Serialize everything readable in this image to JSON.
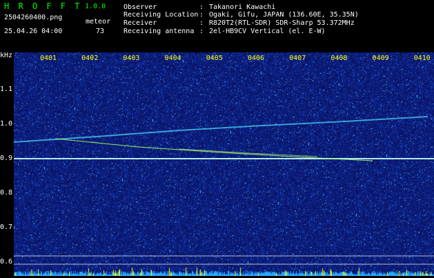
{
  "app": {
    "title": "H R O F F T",
    "version": "1.0.0",
    "filename": "2504260400.png",
    "datetime": "25.04.26 04:00",
    "meteor_label": "meteor",
    "meteor_count": "73"
  },
  "info": [
    {
      "key": "Observer",
      "sep": ":",
      "value": "Takanori Kawachi"
    },
    {
      "key": "Receiving Location",
      "sep": ":",
      "value": "Ogaki, Gifu, JAPAN (136.60E, 35.35N)"
    },
    {
      "key": "Receiver",
      "sep": ":",
      "value": "R820T2(RTL-SDR) SDR-Sharp 53.372MHz"
    },
    {
      "key": "Receiving antenna",
      "sep": ":",
      "value": "2el-HB9CV Vertical (el. E-W)"
    }
  ],
  "axis": {
    "unit": "kHz",
    "freq_ticks": [
      "1.1",
      "1.0",
      "0.9",
      "0.8",
      "0.7",
      "0.6"
    ],
    "time_ticks": [
      "0401",
      "0402",
      "0403",
      "0404",
      "0405",
      "0406",
      "0407",
      "0408",
      "0409",
      "0410"
    ]
  },
  "colors": {
    "background": "#0a1a6a",
    "header_green": "#00ff00",
    "time_label": "#ffff00",
    "carrier": "#c8ffff",
    "trace": "#a0ff60",
    "meteor_bar": "#ffff00"
  }
}
